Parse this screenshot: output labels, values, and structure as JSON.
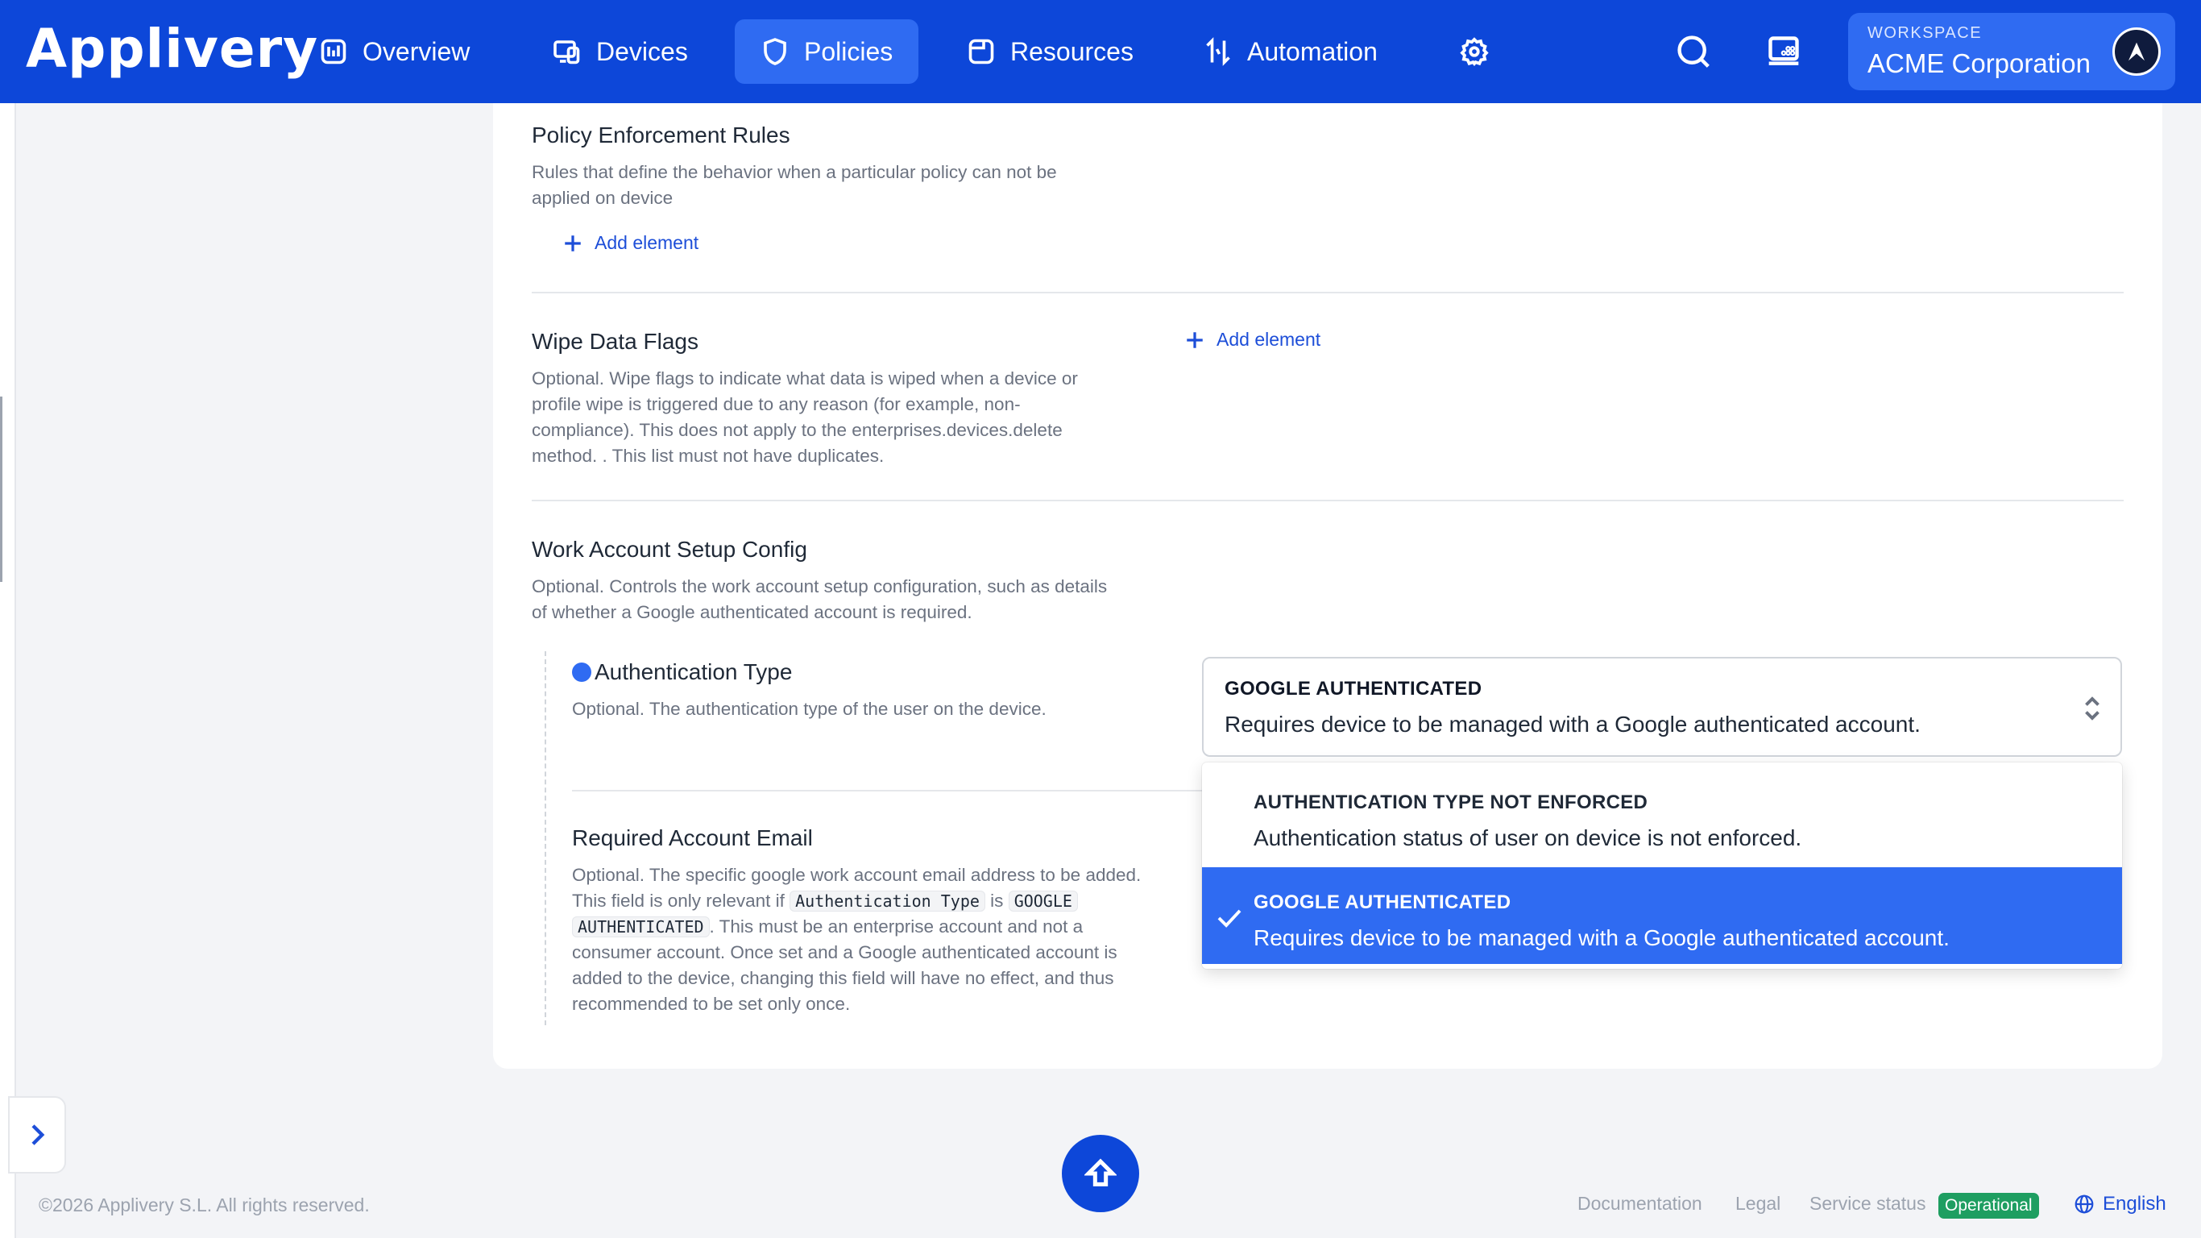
{
  "app": {
    "logo_text": "Applivery"
  },
  "nav": {
    "overview": "Overview",
    "devices": "Devices",
    "policies": "Policies",
    "resources": "Resources",
    "automation": "Automation"
  },
  "workspace": {
    "label": "WORKSPACE",
    "name": "ACME Corporation"
  },
  "sections": {
    "enforcement": {
      "title": "Policy Enforcement Rules",
      "desc1": "Rules that define the behavior when a particular policy can not be",
      "desc2": "applied on device",
      "add": "Add element"
    },
    "wipe": {
      "title": "Wipe Data Flags",
      "desc1": "Optional. Wipe flags to indicate what data is wiped when a device or",
      "desc2": "profile wipe is triggered due to any reason (for example, non-",
      "desc3": "compliance). This does not apply to the enterprises.devices.delete",
      "desc4": "method. . This list must not have duplicates.",
      "add": "Add element"
    },
    "work_account": {
      "title": "Work Account Setup Config",
      "desc1": "Optional. Controls the work account setup configuration, such as details",
      "desc2": "of whether a Google authenticated account is required."
    },
    "auth_type": {
      "title": "Authentication Type",
      "desc": "Optional. The authentication type of the user on the device."
    },
    "required_email": {
      "title": "Required Account Email",
      "desc1": "Optional. The specific google work account email address to be added.",
      "desc2a": "This field is only relevant if",
      "code1": "Authentication Type",
      "desc2b": "is",
      "code2a": "GOOGLE",
      "code2b": "AUTHENTICATED",
      "desc3": ". This must be an enterprise account and not a",
      "desc4": "consumer account. Once set and a Google authenticated account is",
      "desc5": "added to the device, changing this field will have no effect, and thus",
      "desc6": "recommended to be set only once."
    }
  },
  "select": {
    "value_title": "GOOGLE AUTHENTICATED",
    "value_desc": "Requires device to be managed with a Google authenticated account.",
    "options": [
      {
        "title": "AUTHENTICATION TYPE NOT ENFORCED",
        "desc": "Authentication status of user on device is not enforced."
      },
      {
        "title": "GOOGLE AUTHENTICATED",
        "desc": "Requires device to be managed with a Google authenticated account."
      }
    ]
  },
  "footer": {
    "copyright": "©2026 Applivery S.L. All rights reserved.",
    "documentation": "Documentation",
    "legal": "Legal",
    "service_status": "Service status",
    "status_badge": "Operational",
    "language": "English"
  },
  "colors": {
    "nav_bg": "#0d47d9",
    "nav_active": "#2f6bf2",
    "accent": "#1d4ed8",
    "status_ok": "#1e9e61"
  }
}
